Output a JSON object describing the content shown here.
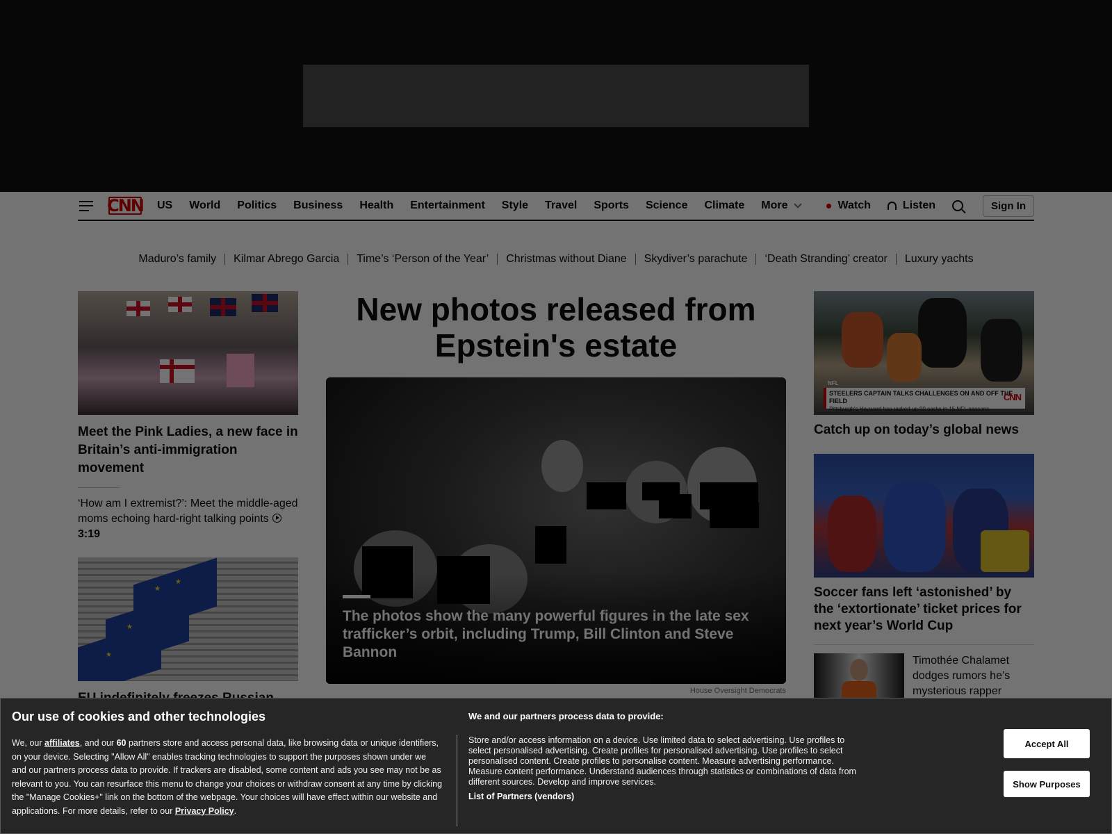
{
  "nav": {
    "logo_text": "CNN",
    "links": [
      "US",
      "World",
      "Politics",
      "Business",
      "Health",
      "Entertainment",
      "Style",
      "Travel",
      "Sports",
      "Science",
      "Climate"
    ],
    "more_label": "More",
    "watch_label": "Watch",
    "listen_label": "Listen",
    "signin_label": "Sign In"
  },
  "trending": [
    "Maduro’s family",
    "Kilmar Abrego Garcia",
    "Time’s ‘Person of the Year’",
    "Christmas without Diane",
    "Skydiver’s parachute",
    "‘Death Stranding’ creator",
    "Luxury yachts"
  ],
  "left": {
    "story1_headline": "Meet the Pink Ladies, a new face in Britain’s anti-immigration movement",
    "story1_sub": "‘How am I extremist?’: Meet the middle-aged moms echoing hard-right talking points",
    "story1_duration": "3:19",
    "story2_headline": "EU indefinitely freezes Russian"
  },
  "center": {
    "lead_title": "New photos released from Epstein's estate",
    "caption": "The photos show the many powerful figures in the late sex trafficker’s orbit, including Trump, Bill Clinton and Steve Bannon",
    "credit": "House Oversight Democrats"
  },
  "right": {
    "nfl_lower_third_title": "STEELERS CAPTAIN TALKS CHALLENGES ON AND OFF THE FIELD",
    "nfl_lower_third_sub": "Pittsburgh's Heyward has racked up 90 sacks in 15 NFL seasons",
    "nfl_tag": "NFL",
    "story1_headline": "Catch up on today’s global news",
    "story2_headline": "Soccer fans left ‘astonished’ by the ‘extortionate’ ticket prices for next year’s World Cup",
    "story3_headline": "Timothée Chalamet dodges rumors he’s mysterious rapper"
  },
  "cookie": {
    "title": "Our use of cookies and other technologies",
    "body_1": "We, our ",
    "affiliates_link": "affiliates",
    "body_2": ", and our ",
    "partner_count": "60",
    "body_3": " partners store and access personal data, like browsing data or unique identifiers, on your device. Selecting \"Allow All\" enables tracking technologies to support the purposes shown under we and our partners process data to provide. If trackers are disabled, some content and ads you see may not be as relevant to you. You can resurface this menu to change your choices or withdraw consent at any time by clicking the \"Manage Cookies+\" link on the bottom of the webpage. Your choices will have effect within our website and applications. For more details, refer to our ",
    "privacy_link": "Privacy Policy",
    "body_end": ".",
    "purposes_title": "We and our partners process data to provide:",
    "purposes_text": "Store and/or access information on a device. Use limited data to select advertising. Use profiles to select personalised advertising. Create profiles for personalised advertising. Use profiles to select personalised content. Create profiles to personalise content. Measure advertising performance. Measure content performance. Understand audiences through statistics or combinations of data from different sources. Develop and improve services.",
    "vendors_link": "List of Partners (vendors)",
    "accept_label": "Accept All",
    "purposes_label": "Show Purposes"
  },
  "colors": {
    "brand_red": "#cc0000",
    "overlay": "rgba(0,0,0,0.55)",
    "cookie_bg": "#262626"
  }
}
